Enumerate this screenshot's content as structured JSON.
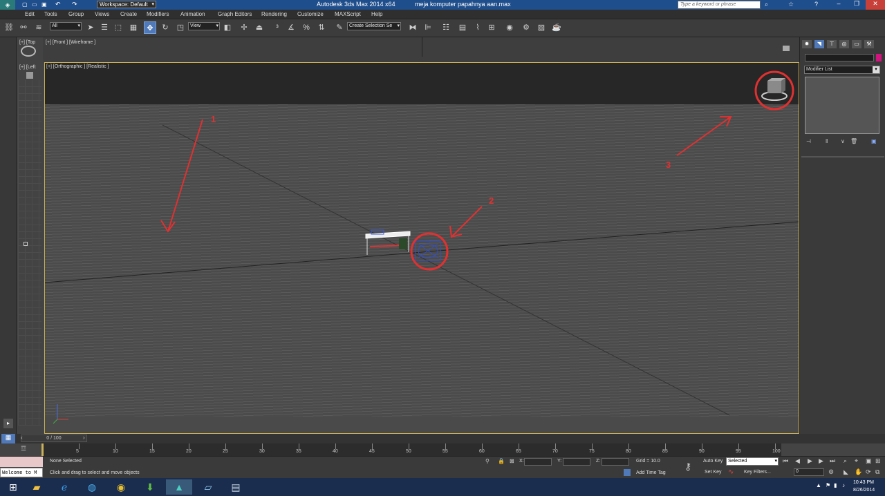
{
  "app": {
    "title": "Autodesk 3ds Max  2014 x64",
    "file": "meja komputer papahnya aan.max",
    "workspace": "Workspace: Default",
    "search_placeholder": "Type a keyword or phrase"
  },
  "menu": [
    "Edit",
    "Tools",
    "Group",
    "Views",
    "Create",
    "Modifiers",
    "Animation",
    "Graph Editors",
    "Rendering",
    "Customize",
    "MAXScript",
    "Help"
  ],
  "toolbar": {
    "filter_select": "All",
    "ref_coord_select": "View",
    "named_selection": "Create Selection Se"
  },
  "viewports": {
    "top_label": "[+] [Top",
    "front_label": "[+] [Front ] [Wireframe ]",
    "left_label": "[+] [Left",
    "main_label": "[+] [Orthographic ] [Realistic ]"
  },
  "annotations": [
    "1",
    "2",
    "3"
  ],
  "command_panel": {
    "modifier_list": "Modifier List",
    "accent_color": "#d4147e"
  },
  "timeline": {
    "frame_counter": "0 / 100",
    "ticks": [
      "5",
      "10",
      "15",
      "20",
      "25",
      "30",
      "35",
      "40",
      "45",
      "50",
      "55",
      "60",
      "65",
      "70",
      "75",
      "80",
      "85",
      "90",
      "95",
      "100"
    ]
  },
  "status": {
    "selection": "None Selected",
    "prompt": "Click and drag to select and move objects",
    "x_label": "X:",
    "y_label": "Y:",
    "z_label": "Z:",
    "grid": "Grid = 10.0",
    "add_time_tag": "Add Time Tag",
    "auto_key": "Auto Key",
    "set_key": "Set Key",
    "key_mode": "Selected",
    "key_filters": "Key Filters...",
    "frame_value": "0",
    "listener": "Welcome to M"
  },
  "clock": {
    "time": "10:43 PM",
    "date": "8/26/2014"
  },
  "colors": {
    "viewport_border": "#c9b05a",
    "annotation": "#e23030",
    "active_tool": "#4f79b8"
  }
}
